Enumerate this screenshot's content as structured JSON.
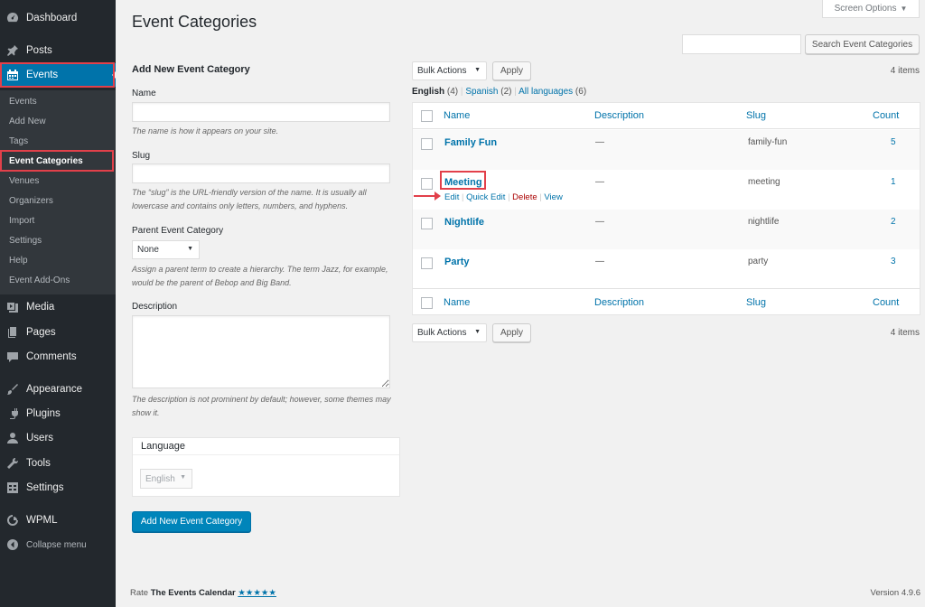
{
  "sidebar": {
    "dashboard": "Dashboard",
    "posts": "Posts",
    "events": "Events",
    "submenu": {
      "events": "Events",
      "add_new": "Add New",
      "tags": "Tags",
      "event_categories": "Event Categories",
      "venues": "Venues",
      "organizers": "Organizers",
      "import": "Import",
      "settings": "Settings",
      "help": "Help",
      "event_addons": "Event Add-Ons"
    },
    "media": "Media",
    "pages": "Pages",
    "comments": "Comments",
    "appearance": "Appearance",
    "plugins": "Plugins",
    "users": "Users",
    "tools": "Tools",
    "settings": "Settings",
    "wpml": "WPML",
    "collapse": "Collapse menu"
  },
  "header": {
    "title": "Event Categories",
    "screen_options": "Screen Options",
    "search_button": "Search Event Categories",
    "search_value": ""
  },
  "form": {
    "heading": "Add New Event Category",
    "name_label": "Name",
    "name_value": "",
    "name_help": "The name is how it appears on your site.",
    "slug_label": "Slug",
    "slug_value": "",
    "slug_help": "The “slug” is the URL-friendly version of the name. It is usually all lowercase and contains only letters, numbers, and hyphens.",
    "parent_label": "Parent Event Category",
    "parent_value": "None",
    "parent_help": "Assign a parent term to create a hierarchy. The term Jazz, for example, would be the parent of Bebop and Big Band.",
    "description_label": "Description",
    "description_value": "",
    "description_help": "The description is not prominent by default; however, some themes may show it.",
    "language_heading": "Language",
    "language_value": "English",
    "submit": "Add New Event Category"
  },
  "list": {
    "bulk_actions": "Bulk Actions",
    "apply": "Apply",
    "items_count": "4 items",
    "languages": {
      "english": "English",
      "english_count": "(4)",
      "sep": "|",
      "spanish": "Spanish",
      "spanish_count": "(2)",
      "all": "All languages",
      "all_count": "(6)"
    },
    "columns": {
      "name": "Name",
      "description": "Description",
      "slug": "Slug",
      "count": "Count"
    },
    "rows": [
      {
        "name": "Family Fun",
        "description": "—",
        "slug": "family-fun",
        "count": "5"
      },
      {
        "name": "Meeting",
        "description": "—",
        "slug": "meeting",
        "count": "1"
      },
      {
        "name": "Nightlife",
        "description": "—",
        "slug": "nightlife",
        "count": "2"
      },
      {
        "name": "Party",
        "description": "—",
        "slug": "party",
        "count": "3"
      }
    ],
    "row_actions": {
      "edit": "Edit",
      "quick_edit": "Quick Edit",
      "delete": "Delete",
      "view": "View",
      "sep": "|"
    }
  },
  "footer": {
    "rate_prefix": "Rate",
    "plugin_name": "The Events Calendar",
    "stars": "★★★★★",
    "version": "Version 4.9.6"
  },
  "colors": {
    "accent": "#0073aa",
    "highlight": "#e2404a",
    "sidebar": "#23282d"
  }
}
